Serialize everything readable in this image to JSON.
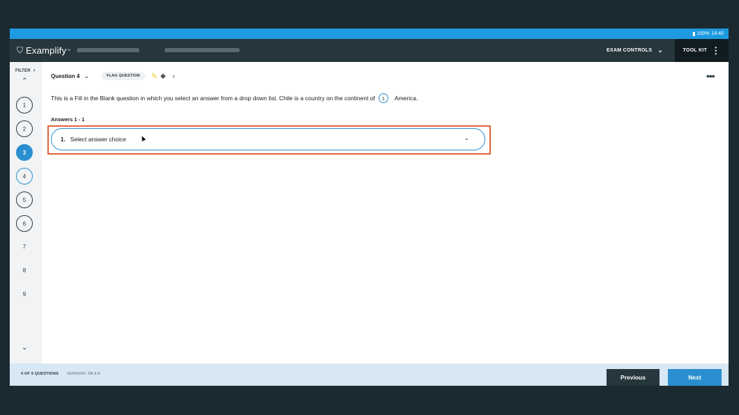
{
  "statusbar": {
    "battery": "100%",
    "time": "14:40"
  },
  "header": {
    "brand": "Examplify",
    "trademark": "™",
    "exam_controls": "EXAM CONTROLS",
    "tool_kit": "TOOL KIT"
  },
  "sidebar": {
    "filter_label": "FILTER",
    "questions": [
      {
        "label": "1",
        "state": "answered"
      },
      {
        "label": "2",
        "state": "answered"
      },
      {
        "label": "3",
        "state": "current"
      },
      {
        "label": "4",
        "state": "selected"
      },
      {
        "label": "5",
        "state": "answered"
      },
      {
        "label": "6",
        "state": "answered"
      },
      {
        "label": "7",
        "state": "plain"
      },
      {
        "label": "8",
        "state": "plain"
      },
      {
        "label": "9",
        "state": "plain"
      }
    ]
  },
  "question": {
    "title": "Question 4",
    "flag_label": "FLAG QUESTION",
    "text_before": "This is a Fill in the Blank question in which you select an answer from a drop down list. Chile is a country on the continent of",
    "blank_number": "1",
    "text_after": "America.",
    "answers_label": "Answers 1 - 1",
    "answer_number": "1.",
    "answer_placeholder": "Select answer choice"
  },
  "footer": {
    "count": "4 OF 9 QUESTIONS",
    "version": "VERSION: 2M.8.0",
    "previous": "Previous",
    "next": "Next"
  },
  "colors": {
    "accent": "#2a8fd0",
    "statusbar": "#1e9ae0",
    "header": "#26363d",
    "highlight": "#e0633c"
  },
  "icons": {
    "brand": "examplify-logo-icon",
    "highlighter": "highlighter-icon",
    "eraser": "eraser-icon"
  }
}
